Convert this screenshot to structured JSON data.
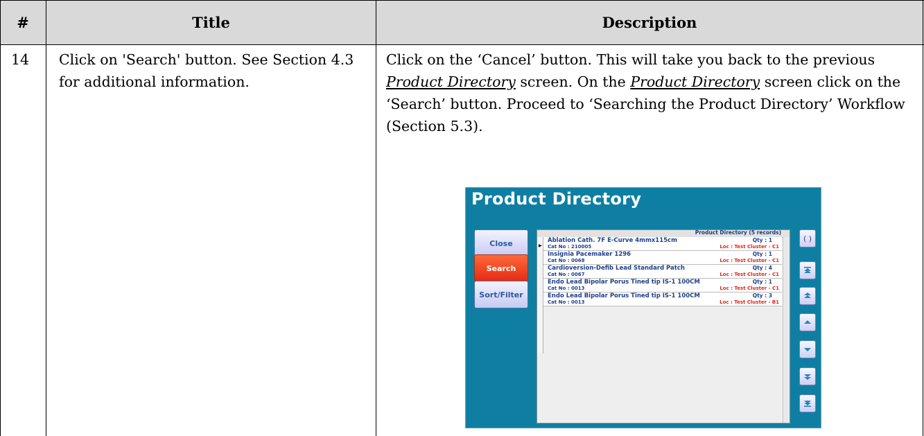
{
  "table": {
    "headers": [
      "#",
      "Title",
      "Description"
    ],
    "row": {
      "number": "14",
      "title": "Click on 'Search' button.  See Section 4.3 for additional information.",
      "desc_part1": "Click on the ‘Cancel’ button.  This will take you back to the previous ",
      "desc_link1": "Product Directory",
      "desc_part2": " screen.  On the ",
      "desc_link2": "Product Directory",
      "desc_part3": " screen click on the ‘Search’ button.  Proceed to ‘Searching the Product Directory’ Workflow (Section 5.3)."
    }
  },
  "app": {
    "title": "Product Directory",
    "buttons": {
      "close": "Close",
      "search": "Search",
      "sort_filter": "Sort/Filter"
    },
    "grid_caption": "Product Directory (5 records)",
    "rows": [
      {
        "name": "Ablation Cath. 7F E-Curve 4mmx115cm",
        "qty": "Qty : 1",
        "cat": "Cat No : 210005",
        "loc": "Loc : Test Cluster -  C1"
      },
      {
        "name": "Insignia Pacemaker 1296",
        "qty": "Qty : 1",
        "cat": "Cat No : 0068",
        "loc": "Loc : Test Cluster -  C1"
      },
      {
        "name": "Cardioversion-Defib Lead Standard Patch",
        "qty": "Qty : 4",
        "cat": "Cat No : 0067",
        "loc": "Loc : Test Cluster -  C1"
      },
      {
        "name": "Endo Lead Bipolar Porus Tined tip IS-1 100CM",
        "qty": "Qty : 1",
        "cat": "Cat No : 0013",
        "loc": "Loc : Test Cluster -  C1"
      },
      {
        "name": "Endo Lead Bipolar Porus Tined tip IS-1 100CM",
        "qty": "Qty : 3",
        "cat": "Cat No : 0013",
        "loc": "Loc : Test Cluster -  B1"
      }
    ],
    "nav_icons": [
      "expand-icon",
      "first-page-icon",
      "page-up-icon",
      "up-icon",
      "down-icon",
      "page-down-icon",
      "last-page-icon"
    ],
    "colors": {
      "background": "#0e7fa3",
      "search_button": "#e32a12",
      "row_text": "#1d3f8c",
      "location_text": "#e0261a"
    }
  }
}
